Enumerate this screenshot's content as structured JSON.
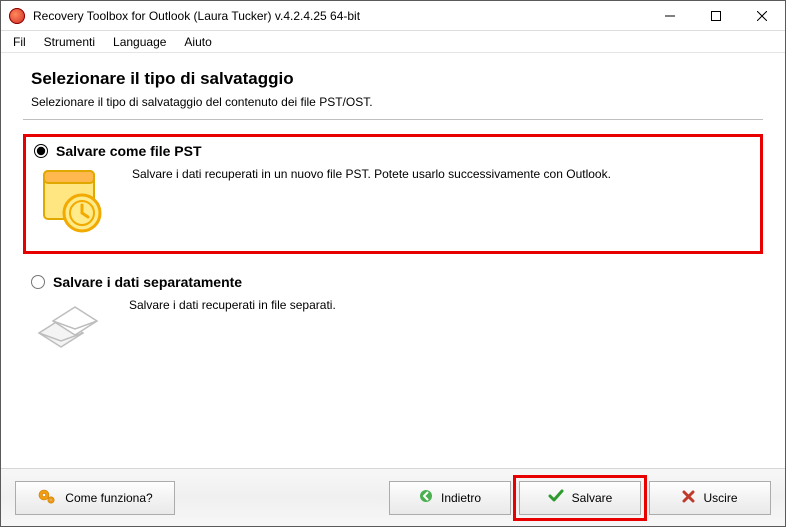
{
  "window": {
    "title": "Recovery Toolbox for Outlook (Laura Tucker) v.4.2.4.25 64-bit"
  },
  "menu": {
    "fil": "Fil",
    "strumenti": "Strumenti",
    "language": "Language",
    "aiuto": "Aiuto"
  },
  "page": {
    "title": "Selezionare il tipo di salvataggio",
    "subtitle": "Selezionare il tipo di salvataggio del contenuto dei file PST/OST."
  },
  "options": {
    "pst": {
      "title": "Salvare come file PST",
      "desc": "Salvare i dati recuperati in un nuovo file PST. Potete usarlo successivamente con Outlook."
    },
    "separate": {
      "title": "Salvare i dati separatamente",
      "desc": "Salvare i dati recuperati in file separati."
    }
  },
  "buttons": {
    "how": "Come funziona?",
    "back": "Indietro",
    "save": "Salvare",
    "exit": "Uscire"
  }
}
